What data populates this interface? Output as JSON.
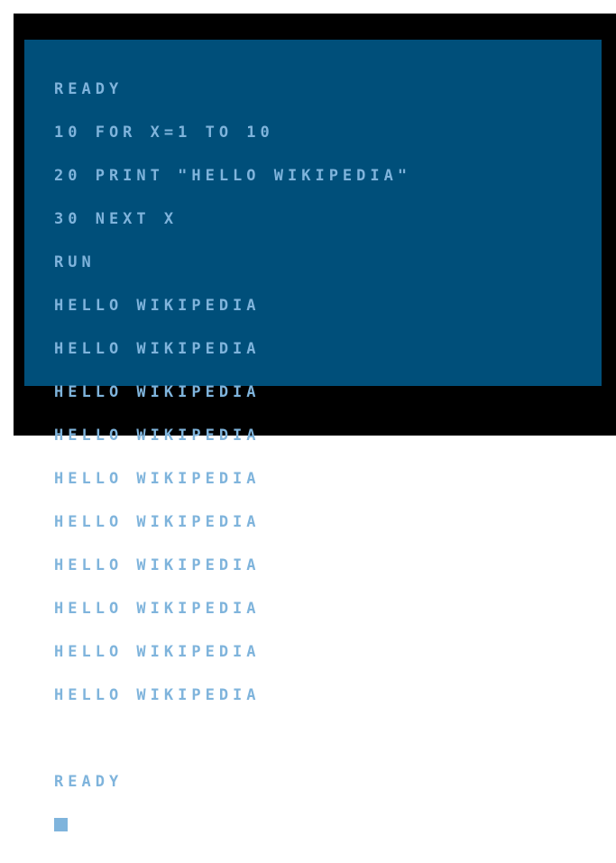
{
  "terminal": {
    "lines": [
      "READY",
      "10 FOR X=1 TO 10",
      "20 PRINT \"HELLO WIKIPEDIA\"",
      "30 NEXT X",
      "RUN",
      "HELLO WIKIPEDIA",
      "HELLO WIKIPEDIA",
      "HELLO WIKIPEDIA",
      "HELLO WIKIPEDIA",
      "HELLO WIKIPEDIA",
      "HELLO WIKIPEDIA",
      "HELLO WIKIPEDIA",
      "HELLO WIKIPEDIA",
      "HELLO WIKIPEDIA",
      "HELLO WIKIPEDIA",
      "",
      "READY"
    ]
  },
  "colors": {
    "screen_background": "#004f7a",
    "text": "#7fb4dc",
    "border": "#000000"
  }
}
